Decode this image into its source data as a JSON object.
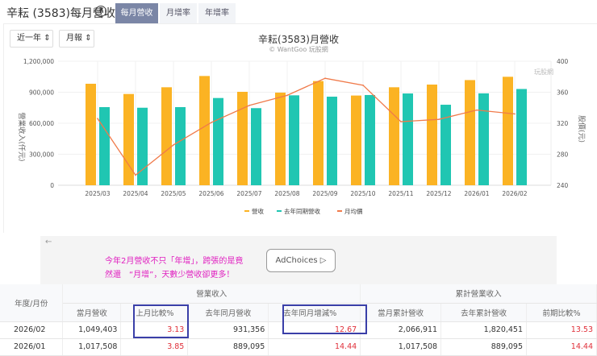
{
  "header": {
    "title": "辛耘 (3583)每月營收",
    "help_icon": "?",
    "tabs": [
      {
        "label": "每月營收",
        "active": true
      },
      {
        "label": "月增率",
        "active": false
      },
      {
        "label": "年增率",
        "active": false
      }
    ]
  },
  "controls": {
    "range": "近一年",
    "period": "月報"
  },
  "chart_data": {
    "type": "bar+line",
    "title": "辛耘(3583)月營收",
    "subtitle": "© WantGoo 玩股網",
    "watermark": "玩股網",
    "categories": [
      "2025/03",
      "2025/04",
      "2025/05",
      "2025/06",
      "2025/07",
      "2025/08",
      "2025/09",
      "2025/10",
      "2025/11",
      "2025/12",
      "2026/01",
      "2026/02"
    ],
    "series": [
      {
        "name": "營收",
        "type": "bar",
        "axis": "left",
        "color": "#fbb323",
        "values": [
          982000,
          883000,
          948000,
          1057000,
          904000,
          896000,
          1008000,
          868000,
          948000,
          974000,
          1017508,
          1049403
        ]
      },
      {
        "name": "去年同期營收",
        "type": "bar",
        "axis": "left",
        "color": "#20c6b2",
        "values": [
          756000,
          750000,
          756000,
          844000,
          746000,
          870000,
          857000,
          873000,
          888000,
          779000,
          889095,
          931356
        ]
      },
      {
        "name": "月均價",
        "type": "line",
        "axis": "right",
        "color": "#f07a4a",
        "values": [
          326,
          253,
          292,
          321,
          343,
          356,
          378,
          369,
          322,
          325,
          337,
          332
        ]
      }
    ],
    "ylabel": "營業收入(仟元)",
    "y2label": "股價(元)",
    "ylim": [
      0,
      1200000
    ],
    "yticks": [
      "0",
      "300,000",
      "600,000",
      "900,000",
      "1,200,000"
    ],
    "y2lim": [
      240,
      400
    ],
    "y2ticks": [
      "240",
      "280",
      "320",
      "360",
      "400"
    ],
    "legend": "bottom"
  },
  "ad": {
    "back": "←",
    "text_line1": "今年2月營收不只「年增」，跨張的是竟",
    "text_line2": "然還　“月增”，天數少營收卻更多！",
    "button": "AdChoices ▷"
  },
  "table": {
    "group1": "營業收入",
    "group2": "累計營業收入",
    "first_col": "年度/月份",
    "columns": [
      "當月營收",
      "上月比較%",
      "去年同月營收",
      "去年同月增減%",
      "當月累計營收",
      "去年累計營收",
      "前期比較%"
    ],
    "rows": [
      [
        "2026/02",
        "1,049,403",
        "3.13",
        "931,356",
        "12.67",
        "2,066,911",
        "1,820,451",
        "13.53"
      ],
      [
        "2026/01",
        "1,017,508",
        "3.85",
        "889,095",
        "14.44",
        "1,017,508",
        "889,095",
        "14.44"
      ]
    ]
  }
}
